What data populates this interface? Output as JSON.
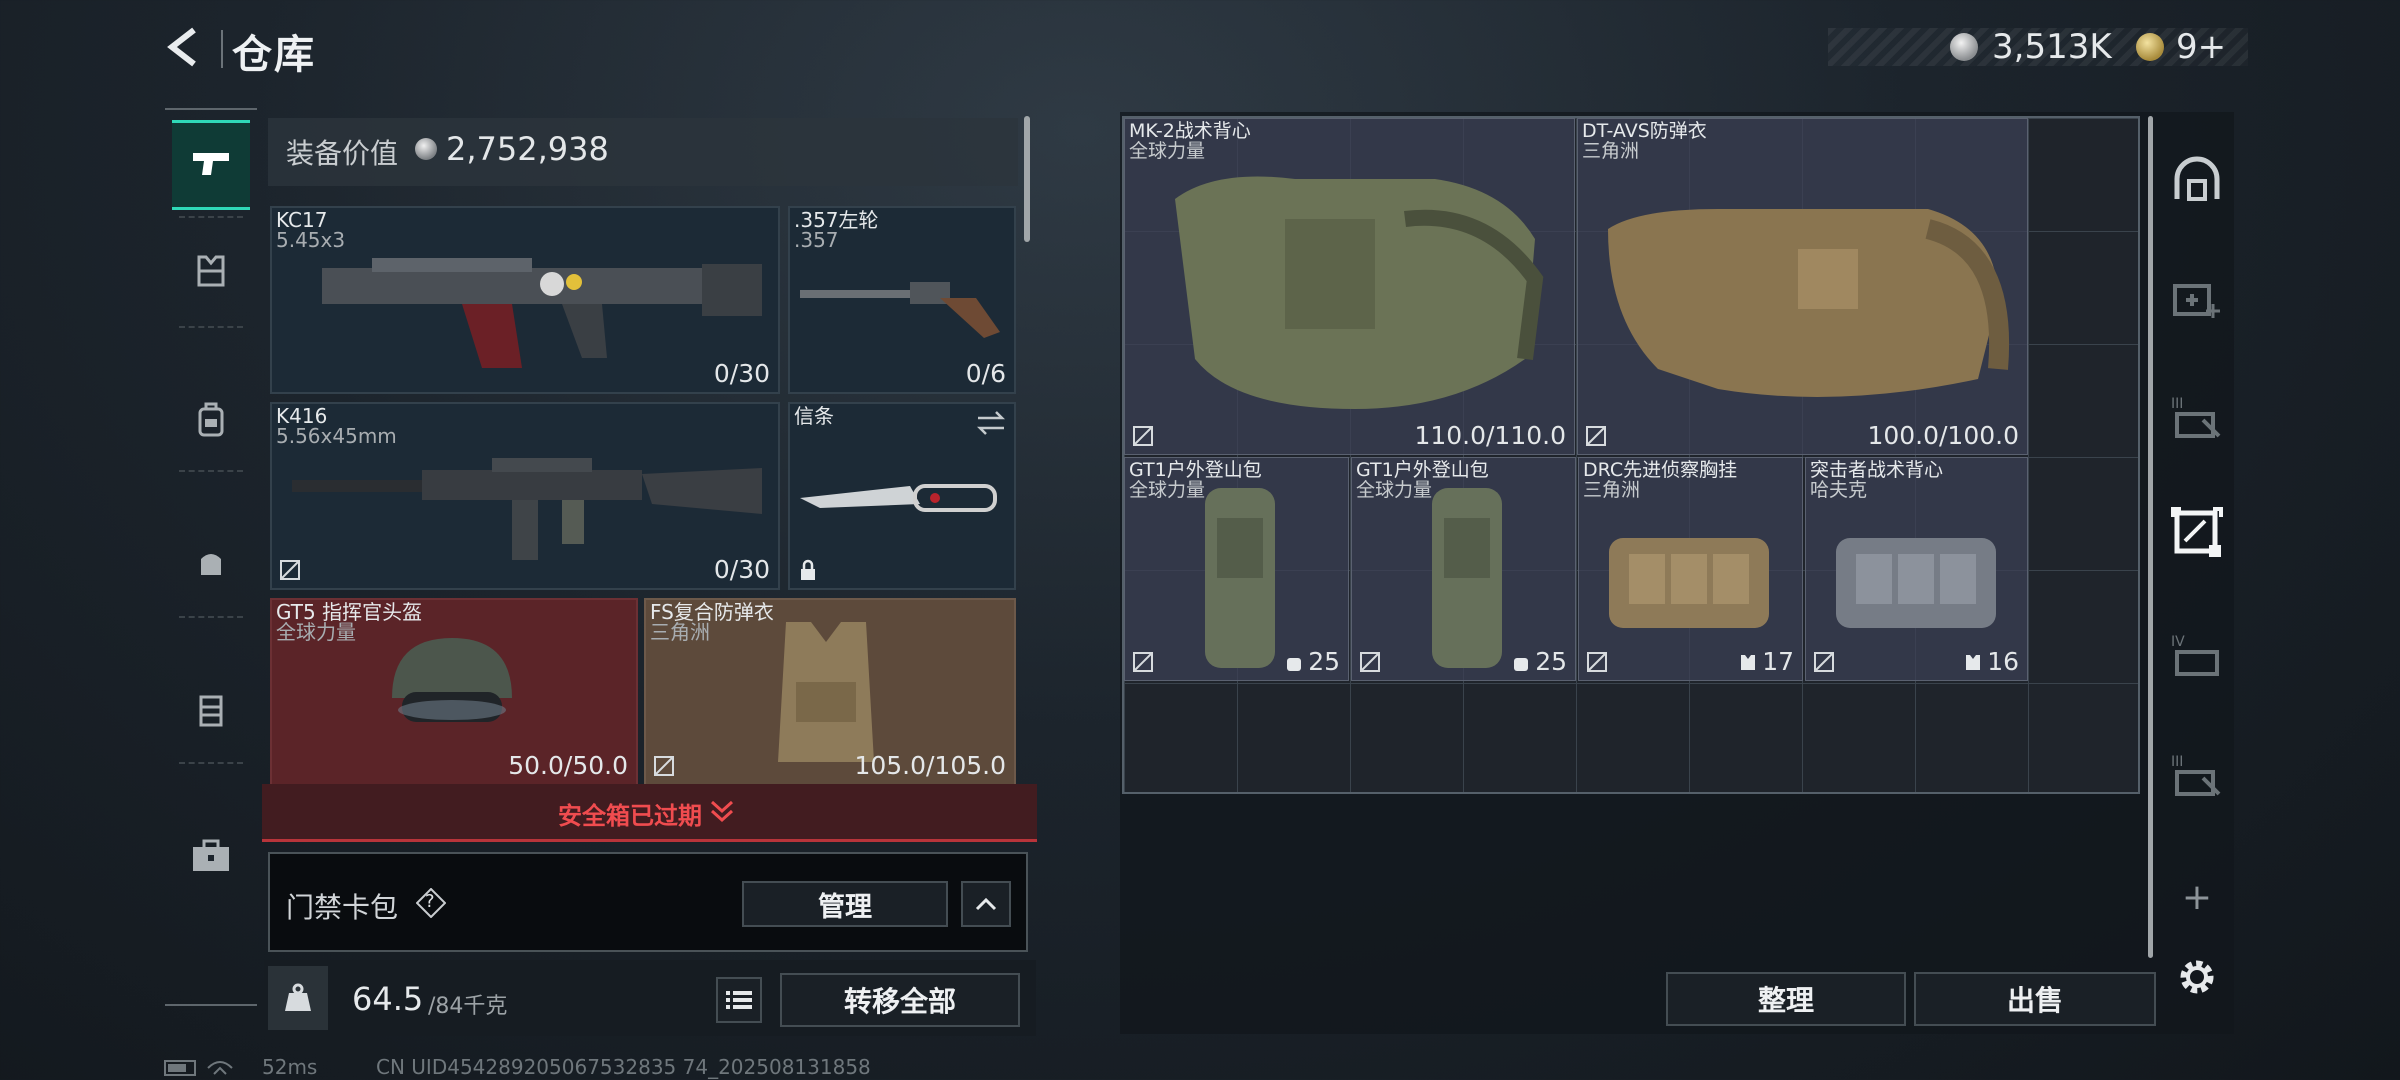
{
  "header": {
    "title": "仓库",
    "silver_amount": "3,513K",
    "gold_amount": "9+"
  },
  "equipment": {
    "value_label": "装备价值",
    "value": "2,752,938",
    "slots": [
      {
        "name": "KC17",
        "sub": "5.45x3",
        "count": "0/30"
      },
      {
        "name": ".357左轮",
        "sub": ".357",
        "count": "0/6"
      },
      {
        "name": "K416",
        "sub": "5.56x45mm",
        "count": "0/30"
      },
      {
        "name": "信条",
        "sub": "",
        "count": ""
      },
      {
        "name": "GT5 指挥官头盔",
        "sub": "全球力量",
        "count": "50.0/50.0"
      },
      {
        "name": "FS复合防弹衣",
        "sub": "三角洲",
        "count": "105.0/105.0"
      }
    ],
    "safebox_expired": "安全箱已过期",
    "keycard_label": "门禁卡包",
    "help_glyph": "?",
    "manage_label": "管理",
    "weight_current": "64.5",
    "weight_max": "/84千克",
    "transfer_all_label": "转移全部"
  },
  "storage": {
    "items": [
      {
        "name": "MK-2战术背心",
        "sub": "全球力量",
        "count": "110.0/110.0",
        "color": "#6b7356"
      },
      {
        "name": "DT-AVS防弹衣",
        "sub": "三角洲",
        "count": "100.0/100.0",
        "color": "#8a7550"
      },
      {
        "name": "GT1户外登山包",
        "sub": "全球力量",
        "count": "25",
        "color": "#66705a"
      },
      {
        "name": "GT1户外登山包",
        "sub": "全球力量",
        "count": "25",
        "color": "#66705a"
      },
      {
        "name": "DRC先进侦察胸挂",
        "sub": "三角洲",
        "count": "17",
        "color": "#8e7a58"
      },
      {
        "name": "突击者战术背心",
        "sub": "哈夫克",
        "count": "16",
        "color": "#767c86"
      }
    ],
    "sort_label": "整理",
    "sell_label": "出售",
    "plus_glyph": "+"
  },
  "status": {
    "ping": "52ms",
    "uid": "CN UID454289205067532835 74_202508131858"
  },
  "colors": {
    "accent": "#2fd9b8",
    "alert": "#f04c4f"
  }
}
